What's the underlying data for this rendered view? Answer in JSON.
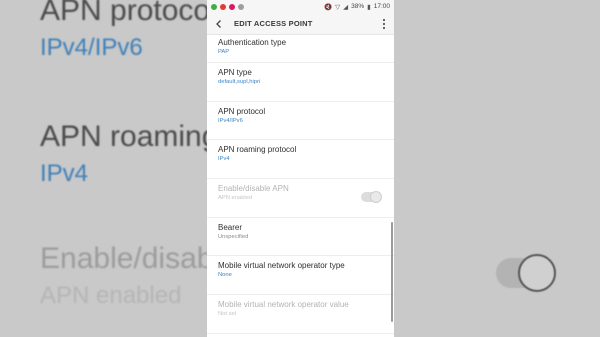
{
  "background": {
    "rows": [
      {
        "label": "APN protocol",
        "value": "IPv4/IPv6"
      },
      {
        "label": "APN roaming protocol",
        "value": "IPv4"
      },
      {
        "label": "Enable/disable APN",
        "value": "APN enabled"
      }
    ]
  },
  "status_bar": {
    "battery": "38%",
    "time": "17:00"
  },
  "app_bar": {
    "title": "EDIT ACCESS POINT"
  },
  "settings": [
    {
      "label": "Authentication type",
      "value": "PAP"
    },
    {
      "label": "APN type",
      "value": "default,supl,hipri"
    },
    {
      "label": "APN protocol",
      "value": "IPv4/IPv6"
    },
    {
      "label": "APN roaming protocol",
      "value": "IPv4"
    },
    {
      "label": "Enable/disable APN",
      "value": "APN enabled",
      "toggle_on": true,
      "disabled": true
    },
    {
      "label": "Bearer",
      "value": "Unspecified"
    },
    {
      "label": "Mobile virtual network operator type",
      "value": "None"
    },
    {
      "label": "Mobile virtual network operator value",
      "value": "Not set",
      "disabled": true
    }
  ],
  "colors": {
    "accent": "#3b86c8",
    "background_blur": "#c9c9c9"
  }
}
